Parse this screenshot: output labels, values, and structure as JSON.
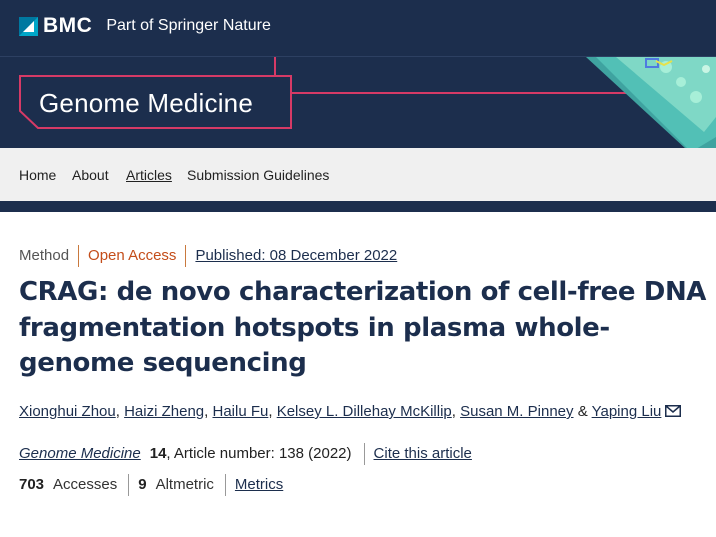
{
  "header": {
    "brand": "BMC",
    "tagline": "Part of Springer Nature"
  },
  "banner": {
    "journal_title": "Genome Medicine"
  },
  "nav": {
    "items": [
      {
        "label": "Home",
        "active": false
      },
      {
        "label": "About",
        "active": false
      },
      {
        "label": "Articles",
        "active": true
      },
      {
        "label": "Submission Guidelines",
        "active": false
      }
    ]
  },
  "article": {
    "type": "Method",
    "access": "Open Access",
    "published": "Published: 08 December 2022",
    "title": "CRAG: de novo characterization of cell-free DNA fragmentation hotspots in plasma whole-genome sequencing",
    "authors": [
      "Xionghui Zhou",
      "Haizi Zheng",
      "Hailu Fu",
      "Kelsey L. Dillehay McKillip",
      "Susan M. Pinney",
      "Yaping Liu"
    ],
    "author_separator": ",",
    "author_last_separator": "&",
    "journal": "Genome Medicine",
    "volume": "14",
    "article_number_text": ", Article number: 138 (2022)",
    "cite_label": "Cite this article",
    "accesses_count": "703",
    "accesses_label": "Accesses",
    "altmetric_count": "9",
    "altmetric_label": "Altmetric",
    "metrics_label": "Metrics"
  },
  "colors": {
    "navy": "#1c2e4d",
    "accent_pink": "#d63a66",
    "bmc_cyan": "#00a6c8",
    "open_access_orange": "#c44d1a",
    "nav_bg": "#f0f0f0"
  }
}
